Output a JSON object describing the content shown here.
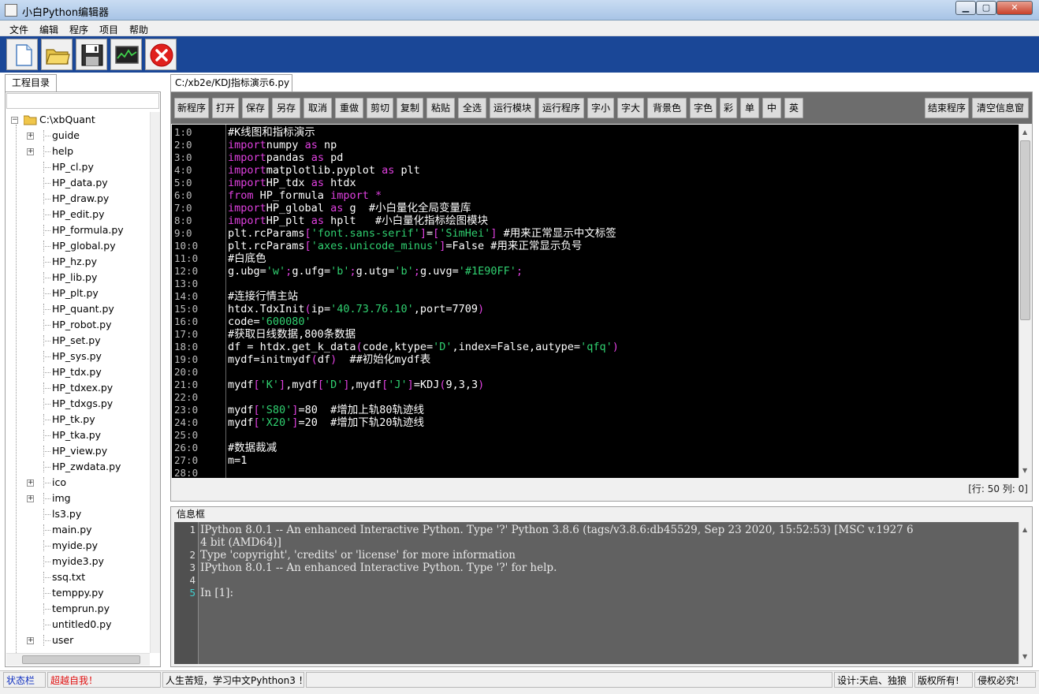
{
  "window": {
    "title": "小白Python编辑器"
  },
  "menu": [
    "文件",
    "编辑",
    "程序",
    "项目",
    "帮助"
  ],
  "toolbar": {
    "icons": [
      "new-file-icon",
      "open-folder-icon",
      "save-icon",
      "monitor-icon",
      "exit-icon"
    ],
    "accent": "#1a4797"
  },
  "project": {
    "tab": "工程目录",
    "root": "C:\\xbQuant",
    "items": [
      {
        "label": "guide",
        "folder": true
      },
      {
        "label": "help",
        "folder": true
      },
      {
        "label": "HP_cl.py"
      },
      {
        "label": "HP_data.py"
      },
      {
        "label": "HP_draw.py"
      },
      {
        "label": "HP_edit.py"
      },
      {
        "label": "HP_formula.py"
      },
      {
        "label": "HP_global.py"
      },
      {
        "label": "HP_hz.py"
      },
      {
        "label": "HP_lib.py"
      },
      {
        "label": "HP_plt.py"
      },
      {
        "label": "HP_quant.py"
      },
      {
        "label": "HP_robot.py"
      },
      {
        "label": "HP_set.py"
      },
      {
        "label": "HP_sys.py"
      },
      {
        "label": "HP_tdx.py"
      },
      {
        "label": "HP_tdxex.py"
      },
      {
        "label": "HP_tdxgs.py"
      },
      {
        "label": "HP_tk.py"
      },
      {
        "label": "HP_tka.py"
      },
      {
        "label": "HP_view.py"
      },
      {
        "label": "HP_zwdata.py"
      },
      {
        "label": "ico",
        "folder": true
      },
      {
        "label": "img",
        "folder": true
      },
      {
        "label": "ls3.py"
      },
      {
        "label": "main.py"
      },
      {
        "label": "myide.py"
      },
      {
        "label": "myide3.py"
      },
      {
        "label": "ssq.txt"
      },
      {
        "label": "temppy.py"
      },
      {
        "label": "temprun.py"
      },
      {
        "label": "untitled0.py"
      },
      {
        "label": "user",
        "folder": true
      }
    ]
  },
  "editor": {
    "tab": "C:/xb2e/KDJ指标演示6.py",
    "buttons": [
      "新程序",
      "打开",
      "保存",
      "另存",
      "取消",
      "重做",
      "剪切",
      "复制",
      "粘贴",
      "全选",
      "运行模块",
      "运行程序",
      "字小",
      "字大",
      "背景色",
      "字色",
      "彩",
      "单",
      "中",
      "英"
    ],
    "right_buttons": [
      "结束程序",
      "清空信息窗"
    ],
    "line_numbers": [
      "1:0",
      "2:0",
      "3:0",
      "4:0",
      "5:0",
      "6:0",
      "7:0",
      "8:0",
      "9:0",
      "10:0",
      "11:0",
      "12:0",
      "13:0",
      "14:0",
      "15:0",
      "16:0",
      "17:0",
      "18:0",
      "19:0",
      "20:0",
      "21:0",
      "22:0",
      "23:0",
      "24:0",
      "25:0",
      "26:0",
      "27:0",
      "28:0"
    ],
    "lines": [
      [
        [
          "cm",
          "#K线图和指标演示"
        ]
      ],
      [
        [
          "kw",
          "import"
        ],
        [
          "",
          "numpy "
        ],
        [
          "kw",
          "as"
        ],
        [
          "",
          " np"
        ]
      ],
      [
        [
          "kw",
          "import"
        ],
        [
          "",
          "pandas "
        ],
        [
          "kw",
          "as"
        ],
        [
          "",
          " pd"
        ]
      ],
      [
        [
          "kw",
          "import"
        ],
        [
          "",
          "matplotlib.pyplot "
        ],
        [
          "kw",
          "as"
        ],
        [
          "",
          " plt"
        ]
      ],
      [
        [
          "kw",
          "import"
        ],
        [
          "",
          "HP_tdx "
        ],
        [
          "kw",
          "as"
        ],
        [
          "",
          " htdx"
        ]
      ],
      [
        [
          "kw",
          "from"
        ],
        [
          "",
          " HP_formula "
        ],
        [
          "kw",
          "import"
        ],
        [
          "",
          " "
        ],
        [
          "kw",
          "*"
        ]
      ],
      [
        [
          "kw",
          "import"
        ],
        [
          "",
          "HP_global "
        ],
        [
          "kw",
          "as"
        ],
        [
          "",
          " g  "
        ],
        [
          "cm",
          "#小白量化全局变量库"
        ]
      ],
      [
        [
          "kw",
          "import"
        ],
        [
          "",
          "HP_plt "
        ],
        [
          "kw",
          "as"
        ],
        [
          "",
          " hplt   "
        ],
        [
          "cm",
          "#小白量化指标绘图模块"
        ]
      ],
      [
        [
          "",
          "plt.rcParams"
        ],
        [
          "kw",
          "["
        ],
        [
          "st",
          "'font.sans-serif'"
        ],
        [
          "kw",
          "]"
        ],
        [
          "",
          "="
        ],
        [
          "kw",
          "["
        ],
        [
          "st",
          "'SimHei'"
        ],
        [
          "kw",
          "]"
        ],
        [
          "",
          " "
        ],
        [
          "cm",
          "#用来正常显示中文标签"
        ]
      ],
      [
        [
          "",
          "plt.rcParams"
        ],
        [
          "kw",
          "["
        ],
        [
          "st",
          "'axes.unicode_minus'"
        ],
        [
          "kw",
          "]"
        ],
        [
          "",
          "=False "
        ],
        [
          "cm",
          "#用来正常显示负号"
        ]
      ],
      [
        [
          "cm",
          "#白底色"
        ]
      ],
      [
        [
          "",
          "g.ubg="
        ],
        [
          "st",
          "'w'"
        ],
        [
          "kw",
          ";"
        ],
        [
          "",
          "g.ufg="
        ],
        [
          "st",
          "'b'"
        ],
        [
          "kw",
          ";"
        ],
        [
          "",
          "g.utg="
        ],
        [
          "st",
          "'b'"
        ],
        [
          "kw",
          ";"
        ],
        [
          "",
          "g.uvg="
        ],
        [
          "st",
          "'#1E90FF'"
        ],
        [
          "kw",
          ";"
        ]
      ],
      [],
      [
        [
          "cm",
          "#连接行情主站"
        ]
      ],
      [
        [
          "",
          "htdx.TdxInit"
        ],
        [
          "kw",
          "("
        ],
        [
          "",
          "ip="
        ],
        [
          "st",
          "'40.73.76.10'"
        ],
        [
          "",
          ",port=7709"
        ],
        [
          "kw",
          ")"
        ]
      ],
      [
        [
          "",
          "code="
        ],
        [
          "st",
          "'600080'"
        ]
      ],
      [
        [
          "cm",
          "#获取日线数据,800条数据"
        ]
      ],
      [
        [
          "",
          "df = htdx.get_k_data"
        ],
        [
          "kw",
          "("
        ],
        [
          "",
          "code,ktype="
        ],
        [
          "st",
          "'D'"
        ],
        [
          "",
          ",index=False,autype="
        ],
        [
          "st",
          "'qfq'"
        ],
        [
          "kw",
          ")"
        ]
      ],
      [
        [
          "",
          "mydf=initmydf"
        ],
        [
          "kw",
          "("
        ],
        [
          "",
          "df"
        ],
        [
          "kw",
          ")"
        ],
        [
          "",
          "  "
        ],
        [
          "cm",
          "##初始化mydf表"
        ]
      ],
      [],
      [
        [
          "",
          "mydf"
        ],
        [
          "kw",
          "["
        ],
        [
          "st",
          "'K'"
        ],
        [
          "kw",
          "]"
        ],
        [
          "",
          ",mydf"
        ],
        [
          "kw",
          "["
        ],
        [
          "st",
          "'D'"
        ],
        [
          "kw",
          "]"
        ],
        [
          "",
          ",mydf"
        ],
        [
          "kw",
          "["
        ],
        [
          "st",
          "'J'"
        ],
        [
          "kw",
          "]"
        ],
        [
          "",
          "=KDJ"
        ],
        [
          "kw",
          "("
        ],
        [
          "",
          "9,3,3"
        ],
        [
          "kw",
          ")"
        ]
      ],
      [],
      [
        [
          "",
          "mydf"
        ],
        [
          "kw",
          "["
        ],
        [
          "st",
          "'S80'"
        ],
        [
          "kw",
          "]"
        ],
        [
          "",
          "=80  "
        ],
        [
          "cm",
          "#增加上轨80轨迹线"
        ]
      ],
      [
        [
          "",
          "mydf"
        ],
        [
          "kw",
          "["
        ],
        [
          "st",
          "'X20'"
        ],
        [
          "kw",
          "]"
        ],
        [
          "",
          "=20  "
        ],
        [
          "cm",
          "#增加下轨20轨迹线"
        ]
      ],
      [],
      [
        [
          "cm",
          "#数据裁减"
        ]
      ],
      [
        [
          "",
          "m=1"
        ]
      ],
      []
    ],
    "status": "[行: 50   列: 0]"
  },
  "info": {
    "label": "信息框",
    "line_numbers": [
      "1",
      "2",
      "3",
      "4",
      "5"
    ],
    "lines": [
      "IPython 8.0.1 -- An enhanced Interactive Python. Type '?' Python 3.8.6 (tags/v3.8.6:db45529, Sep 23 2020, 15:52:53) [MSC v.1927 6",
      "4 bit (AMD64)]",
      "Type 'copyright', 'credits' or 'license' for more information",
      "IPython 8.0.1 -- An enhanced Interactive Python. Type '?' for help.",
      "",
      "In [1]:"
    ]
  },
  "statusbar": {
    "status": "状态栏",
    "slogan": "超越自我！",
    "motto": "人生苦短，学习中文Pyhthon3 ！",
    "design": "设计:天启、独狼",
    "rights": "版权所有!",
    "warning": "侵权必究!"
  }
}
